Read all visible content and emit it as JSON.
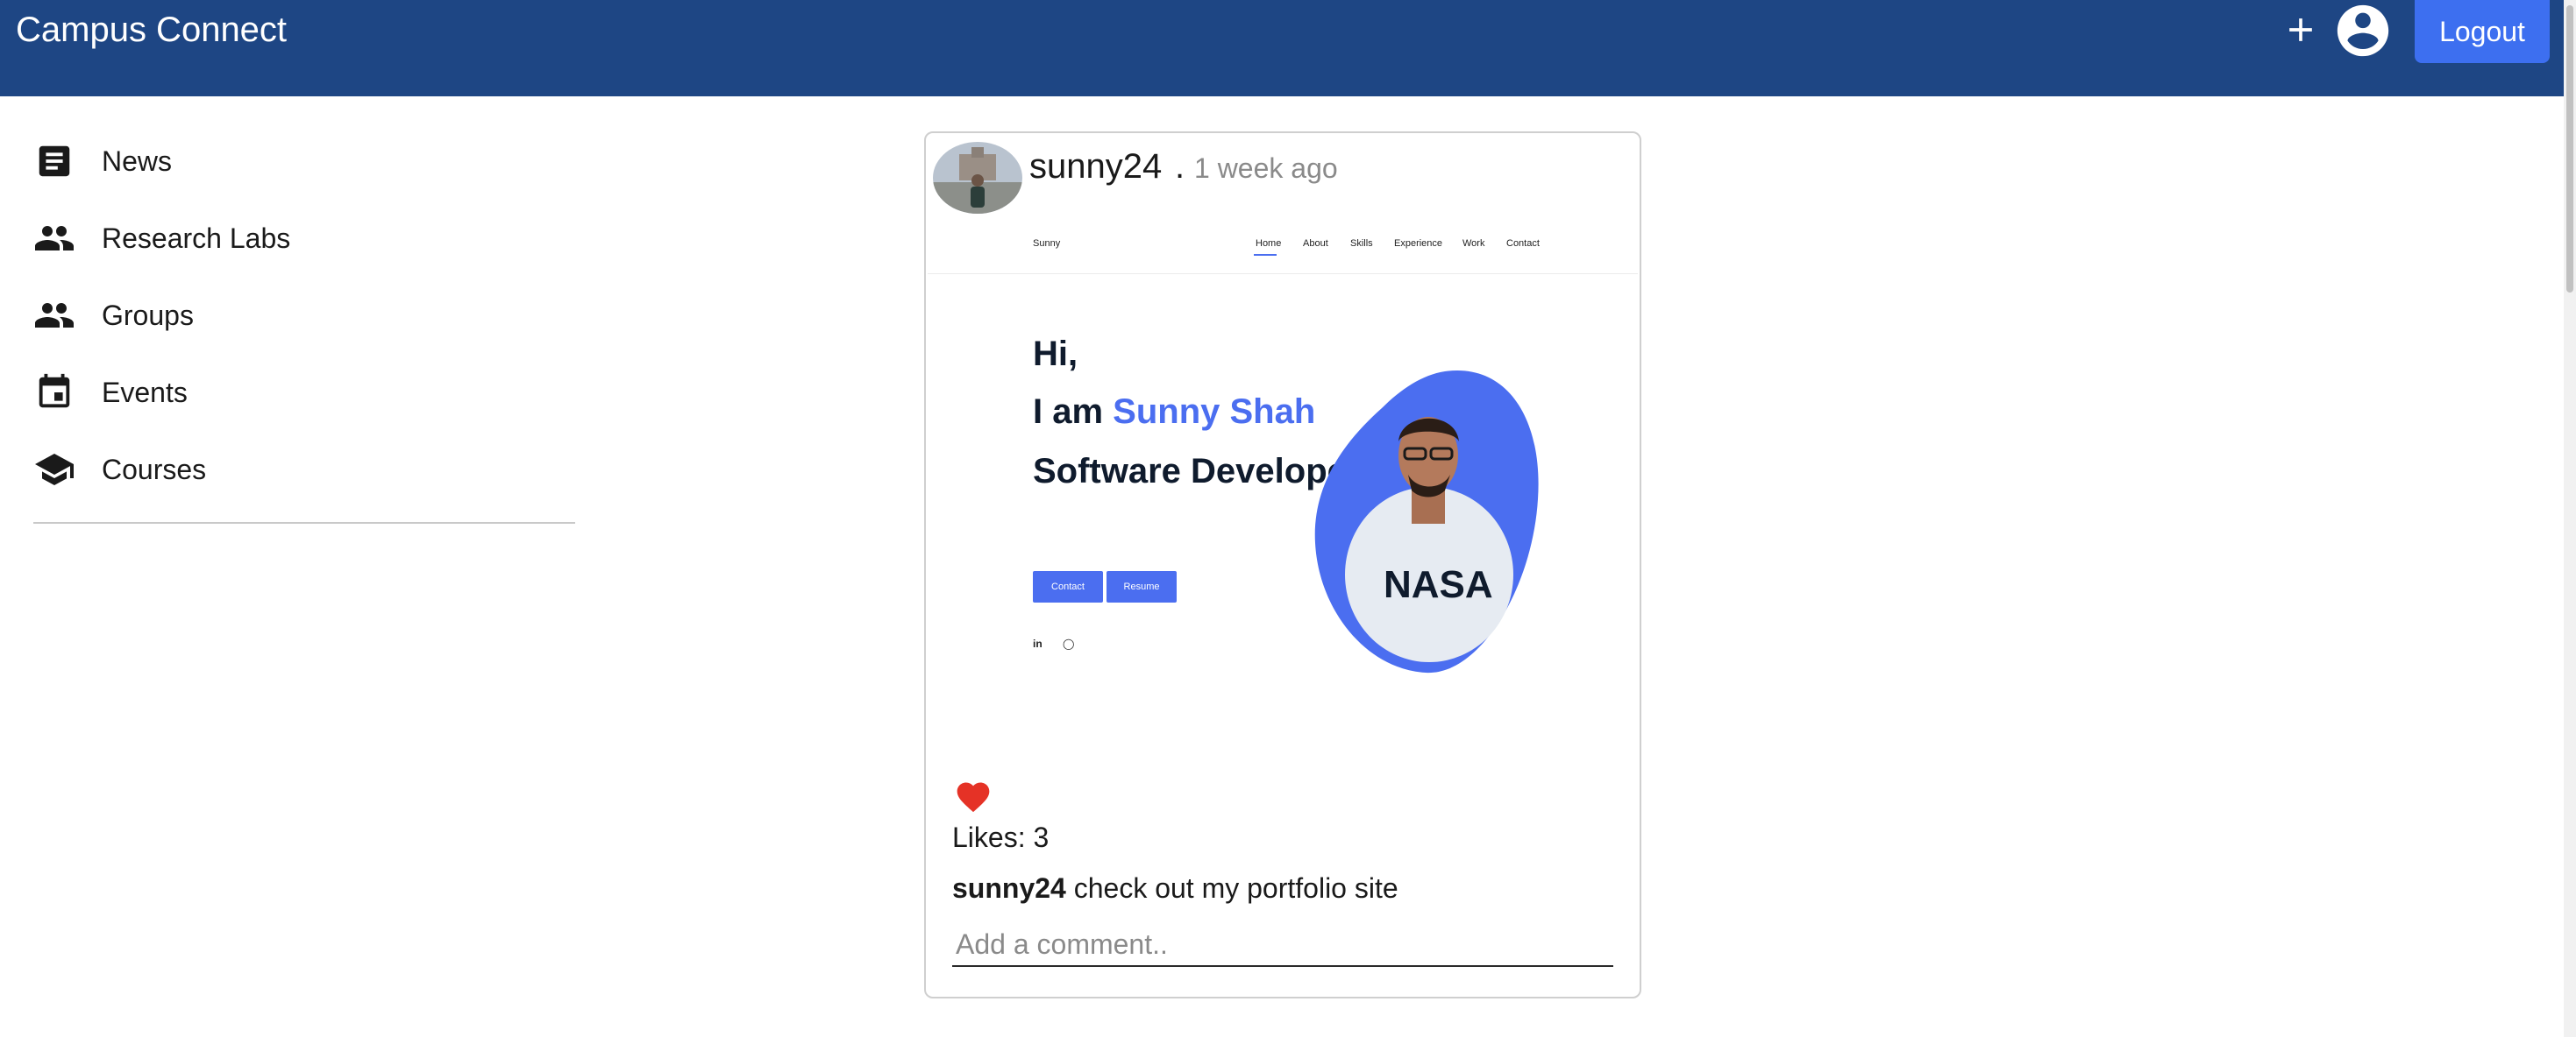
{
  "app": {
    "title": "Campus Connect",
    "logout_label": "Logout",
    "header_color": "#1e4684",
    "accent_color": "#3d6ff0"
  },
  "header": {
    "add_icon": "plus-icon",
    "account_icon": "account-circle-icon"
  },
  "sidebar": {
    "items": [
      {
        "label": "News",
        "icon": "article-icon"
      },
      {
        "label": "Research Labs",
        "icon": "people-icon"
      },
      {
        "label": "Groups",
        "icon": "people-icon"
      },
      {
        "label": "Events",
        "icon": "event-icon"
      },
      {
        "label": "Courses",
        "icon": "school-icon"
      }
    ]
  },
  "post": {
    "username": "sunny24",
    "separator": ".",
    "time": "1 week ago",
    "likes_label": "Likes: 3",
    "caption_user": "sunny24",
    "caption_text": " check out my portfolio site",
    "comment_placeholder": "Add a comment..",
    "like_icon": "heart-icon",
    "like_color": "#e53226",
    "preview": {
      "brand": "Sunny",
      "nav": [
        "Home",
        "About",
        "Skills",
        "Experience",
        "Work",
        "Contact"
      ],
      "greeting": "Hi,",
      "intro_prefix": "I am ",
      "name": "Sunny Shah",
      "role": "Software Developer",
      "buttons": [
        "Contact",
        "Resume"
      ],
      "social": [
        "in",
        "◯"
      ],
      "shirt_text": "NASA",
      "accent_color": "#4b6ef0"
    }
  }
}
